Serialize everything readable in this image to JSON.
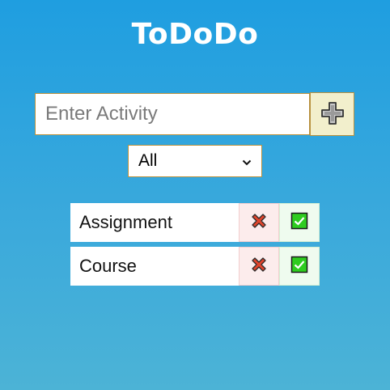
{
  "app": {
    "title": "ToDoDo"
  },
  "form": {
    "input_placeholder": "Enter Activity",
    "input_value": "",
    "add_icon": "plus-icon"
  },
  "filter": {
    "selected": "All",
    "icon": "chevron-down-icon"
  },
  "todos": [
    {
      "text": "Assignment",
      "delete_icon": "cross-icon",
      "complete_icon": "checkmark-icon"
    },
    {
      "text": "Course",
      "delete_icon": "cross-icon",
      "complete_icon": "checkmark-icon"
    }
  ],
  "colors": {
    "background_top": "#1f9ee0",
    "background_bottom": "#4cb3d6",
    "add_button_bg": "#f2efcc",
    "input_border": "#b8913f",
    "delete_icon_red": "#e0452d",
    "complete_icon_green": "#2ecc1f"
  }
}
